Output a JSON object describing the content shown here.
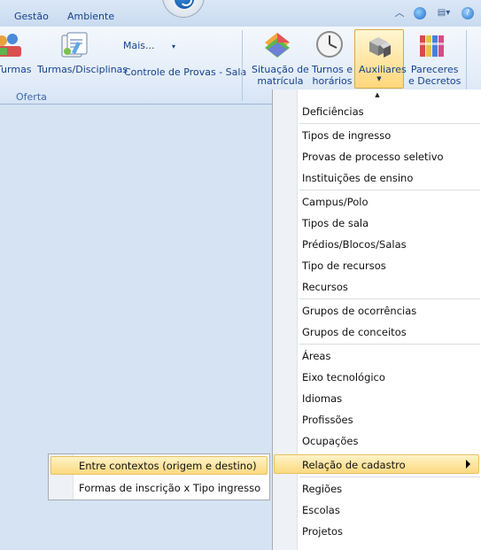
{
  "tabs": [
    {
      "label": "Gestão"
    },
    {
      "label": "Ambiente"
    }
  ],
  "ribbon": {
    "turmas_label": "Turmas",
    "turmas_disciplinas_label": "Turmas/Disciplinas",
    "mais_label": "Mais...",
    "controle_provas_label": "Controle de Provas - Sala",
    "oferta_group": "Oferta",
    "situacao_label_1": "Situação de",
    "situacao_label_2": "matrícula",
    "turnos_label_1": "Turnos e",
    "turnos_label_2": "horários",
    "auxiliares_label": "Auxiliares",
    "pareceres_label_1": "Pareceres",
    "pareceres_label_2": "e Decretos"
  },
  "menu": {
    "items": [
      "Deficiências",
      "Tipos de ingresso",
      "Provas de processo seletivo",
      "Instituições de ensino",
      "Campus/Polo",
      "Tipos de sala",
      "Prédios/Blocos/Salas",
      "Tipo de recursos",
      "Recursos",
      "Grupos de ocorrências",
      "Grupos de conceitos",
      "Áreas",
      "Eixo tecnológico",
      "Idiomas",
      "Profissões",
      "Ocupações",
      "Relação de cadastro",
      "Regiões",
      "Escolas",
      "Projetos"
    ]
  },
  "submenu": {
    "items": [
      "Entre contextos (origem e destino)",
      "Formas de inscrição x Tipo ingresso"
    ]
  },
  "colors": {
    "ribbon_bg": "#e2ecf8",
    "highlight": "#fbd97f",
    "text_blue": "#15428b"
  }
}
